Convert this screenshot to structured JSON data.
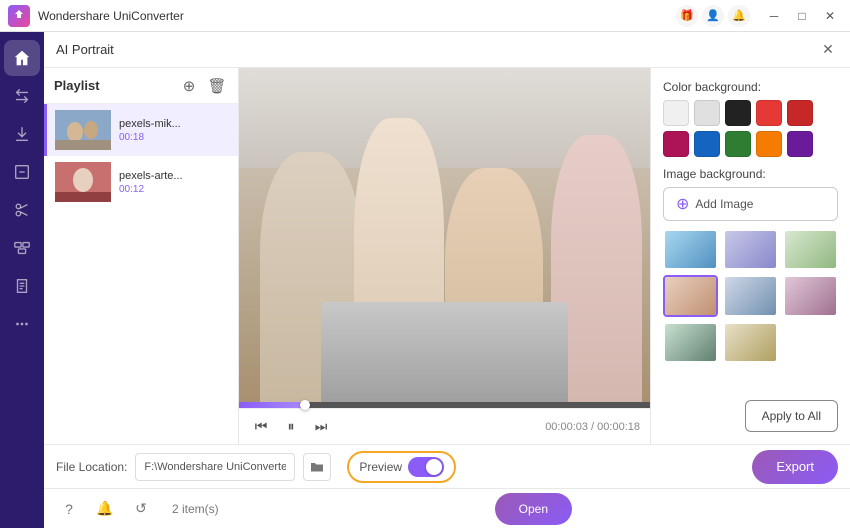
{
  "app": {
    "title": "Wondershare UniConverter",
    "logo_color": "#8b5cf6"
  },
  "titlebar": {
    "icons": [
      "gift-icon",
      "user-icon",
      "bell-icon"
    ],
    "controls": [
      "minimize-btn",
      "maximize-btn",
      "close-btn"
    ],
    "minimize_label": "─",
    "maximize_label": "□",
    "close_label": "✕"
  },
  "sidebar": {
    "items": [
      {
        "id": "home",
        "icon": "home-icon",
        "active": true
      },
      {
        "id": "convert",
        "icon": "convert-icon"
      },
      {
        "id": "download",
        "icon": "download-icon"
      },
      {
        "id": "edit",
        "icon": "edit-icon"
      },
      {
        "id": "cut",
        "icon": "cut-icon"
      },
      {
        "id": "merge",
        "icon": "merge-icon"
      },
      {
        "id": "compress",
        "icon": "compress-icon"
      },
      {
        "id": "more",
        "icon": "more-icon"
      }
    ]
  },
  "panel": {
    "title": "AI Portrait",
    "close_label": "✕"
  },
  "playlist": {
    "title": "Playlist",
    "items": [
      {
        "name": "pexels-mik...",
        "duration": "00:18",
        "active": true
      },
      {
        "name": "pexels-arte...",
        "duration": "00:12",
        "active": false
      }
    ],
    "count": "2 item(s)"
  },
  "video": {
    "current_time": "00:00:03",
    "total_time": "00:00:18",
    "time_display": "00:00:03 / 00:00:18",
    "progress_percent": 16
  },
  "controls": {
    "prev_label": "⏮",
    "play_label": "⏸",
    "next_label": "⏭"
  },
  "background": {
    "color_section_title": "Color background:",
    "image_section_title": "Image background:",
    "add_image_label": "Add Image",
    "colors": [
      {
        "value": "#f0f0f0",
        "label": "white"
      },
      {
        "value": "#e0e0e0",
        "label": "light-gray"
      },
      {
        "value": "#222222",
        "label": "black"
      },
      {
        "value": "#e53935",
        "label": "red"
      },
      {
        "value": "#c62828",
        "label": "dark-red"
      },
      {
        "value": "#ad1457",
        "label": "pink"
      },
      {
        "value": "#1565c0",
        "label": "blue"
      },
      {
        "value": "#2e7d32",
        "label": "green"
      },
      {
        "value": "#f57c00",
        "label": "orange"
      },
      {
        "value": "#6a1b9a",
        "label": "purple"
      }
    ],
    "thumbnails": [
      {
        "id": 1,
        "class": "bgt-1"
      },
      {
        "id": 2,
        "class": "bgt-2"
      },
      {
        "id": 3,
        "class": "bgt-3"
      },
      {
        "id": 4,
        "class": "bgt-4",
        "selected": true
      },
      {
        "id": 5,
        "class": "bgt-5"
      },
      {
        "id": 6,
        "class": "bgt-6"
      },
      {
        "id": 7,
        "class": "bgt-7"
      },
      {
        "id": 8,
        "class": "bgt-8"
      }
    ],
    "apply_all_label": "Apply to All"
  },
  "bottom_bar": {
    "file_location_label": "File Location:",
    "file_path": "F:\\Wondershare UniConverter",
    "folder_icon": "folder-icon",
    "preview_label": "Preview",
    "preview_enabled": true,
    "export_label": "Export"
  },
  "bottom_nav": {
    "help_icon": "help-icon",
    "notification_icon": "notification-icon",
    "feedback_icon": "feedback-icon",
    "open_label": "Open"
  }
}
